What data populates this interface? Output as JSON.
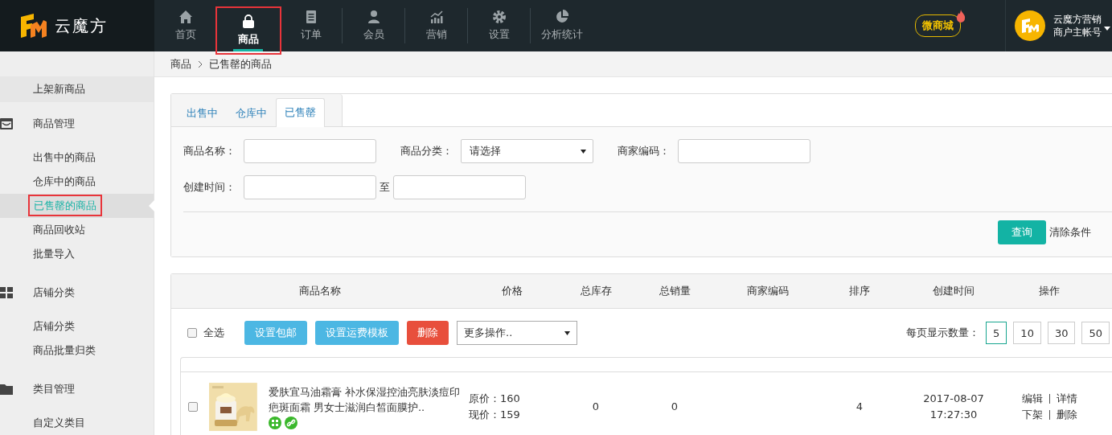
{
  "header": {
    "logo": "云魔方",
    "nav": [
      {
        "label": "首页",
        "selected": false
      },
      {
        "label": "商品",
        "selected": true
      },
      {
        "label": "订单",
        "selected": false
      },
      {
        "label": "会员",
        "selected": false
      },
      {
        "label": "营销",
        "selected": false
      },
      {
        "label": "设置",
        "selected": false
      },
      {
        "label": "分析统计",
        "selected": false
      }
    ],
    "shop_badge": "微商城",
    "account": {
      "name": "云魔方营销",
      "role": "商户主帐号"
    }
  },
  "sidebar": {
    "items": [
      {
        "kind": "link",
        "label": "上架新商品",
        "selected": false
      },
      {
        "kind": "group",
        "label": "商品管理",
        "children": [
          {
            "label": "出售中的商品",
            "selected": false
          },
          {
            "label": "仓库中的商品",
            "selected": false
          },
          {
            "label": "已售罄的商品",
            "selected": true
          },
          {
            "label": "商品回收站",
            "selected": false
          },
          {
            "label": "批量导入",
            "selected": false
          }
        ]
      },
      {
        "kind": "group",
        "label": "店铺分类",
        "children": [
          {
            "label": "店铺分类",
            "selected": false
          },
          {
            "label": "商品批量归类",
            "selected": false
          }
        ]
      },
      {
        "kind": "group",
        "label": "类目管理",
        "children": [
          {
            "label": "自定义类目",
            "selected": false
          }
        ]
      }
    ]
  },
  "breadcrumb": [
    "商品",
    "已售罄的商品"
  ],
  "tabs": [
    {
      "label": "出售中",
      "selected": false
    },
    {
      "label": "仓库中",
      "selected": false
    },
    {
      "label": "已售罄",
      "selected": true
    }
  ],
  "filters": [
    [
      {
        "kind": "input",
        "label": "商品名称："
      },
      {
        "kind": "select",
        "label": "商品分类：",
        "value": "请选择"
      },
      {
        "kind": "input",
        "label": "商家编码："
      }
    ],
    [
      {
        "kind": "range",
        "label": "创建时间：",
        "separator": "至"
      }
    ]
  ],
  "query_button": "查询",
  "clear_link": "清除条件",
  "table": {
    "columns": [
      "商品名称",
      "价格",
      "总库存",
      "总销量",
      "商家编码",
      "排序",
      "创建时间",
      "操作"
    ],
    "select_all": {
      "label": "全选",
      "checked": false
    },
    "actions": [
      {
        "label": "设置包邮",
        "kind": "info"
      },
      {
        "label": "设置运费模板",
        "kind": "info"
      },
      {
        "label": "删除",
        "kind": "danger"
      }
    ],
    "more_select": "更多操作..",
    "page_size_label": "每页显示数量：",
    "page_sizes": [
      {
        "label": "5",
        "selected": true
      },
      {
        "label": "10",
        "selected": false
      },
      {
        "label": "30",
        "selected": false
      },
      {
        "label": "50",
        "selected": false
      }
    ],
    "rows": [
      {
        "checked": false,
        "title": "爱肤宜马油霜膏 补水保湿控油亮肤淡痘印疤斑面霜 男女士滋润白皙面膜护..",
        "original_price": "原价：160",
        "current_price": "现价：159",
        "stock": "0",
        "sales": "0",
        "sort": "4",
        "date": "2017-08-07",
        "time": "17:27:30",
        "operations": [
          [
            "编辑",
            "详情"
          ],
          [
            "下架",
            "删除"
          ]
        ]
      }
    ]
  }
}
